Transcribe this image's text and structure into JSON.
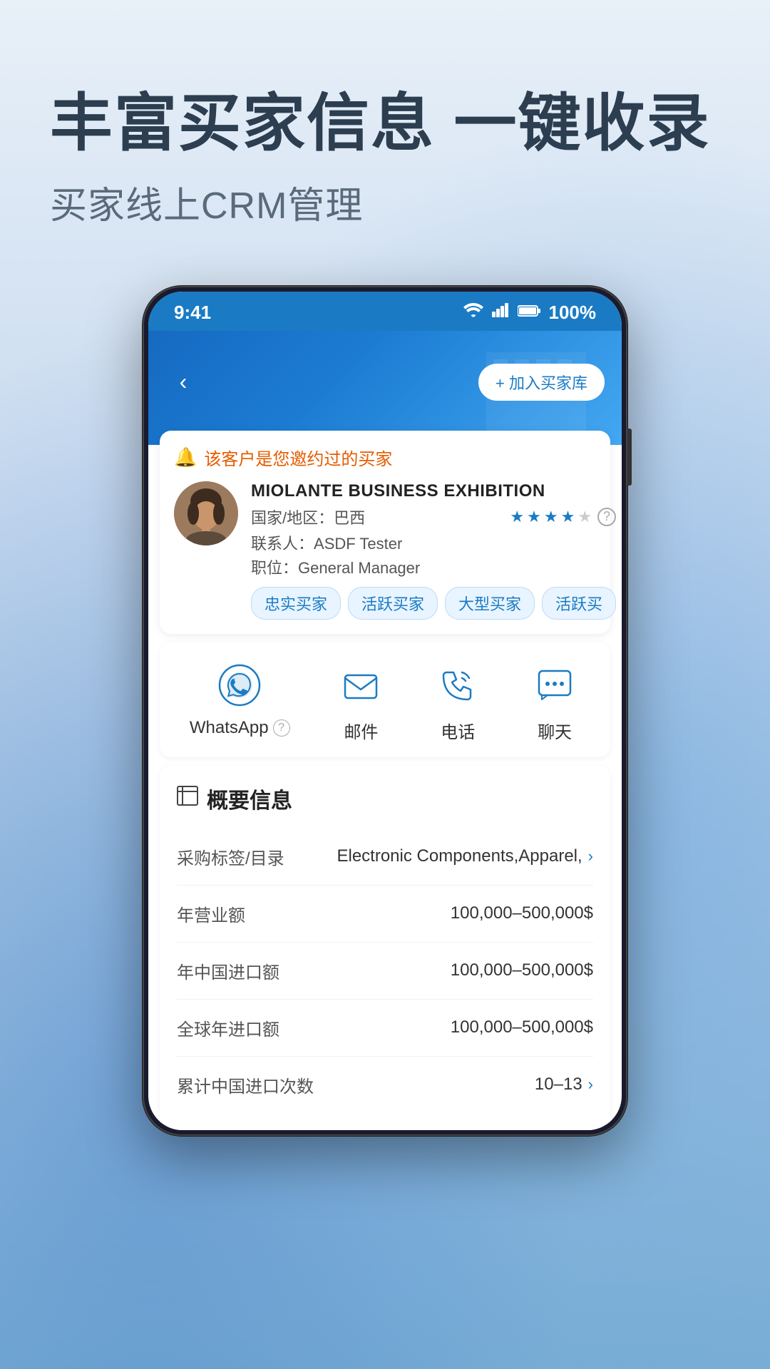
{
  "page": {
    "background": "gradient-blue"
  },
  "header": {
    "main_title": "丰富买家信息 一键收录",
    "sub_title": "买家线上CRM管理"
  },
  "status_bar": {
    "time": "9:41",
    "wifi_icon": "wifi",
    "signal_icon": "signal",
    "battery_icon": "battery",
    "battery_text": "100%"
  },
  "phone_top_bar": {
    "back_label": "‹",
    "add_buyer_label": "+ 加入买家库"
  },
  "customer_notice": {
    "text": "该客户是您邀约过的买家"
  },
  "customer": {
    "company_name": "MIOLANTE BUSINESS EXHIBITION",
    "country_label": "国家/地区：",
    "country": "巴西",
    "stars_filled": 4,
    "stars_empty": 1,
    "contact_label": "联系人：",
    "contact_name": "ASDF Tester",
    "position_label": "职位：",
    "position": "General Manager",
    "tags": [
      "忠实买家",
      "活跃买家",
      "大型买家",
      "活跃买"
    ]
  },
  "actions": [
    {
      "id": "whatsapp",
      "label": "WhatsApp",
      "has_help": true
    },
    {
      "id": "email",
      "label": "邮件",
      "has_help": false
    },
    {
      "id": "phone",
      "label": "电话",
      "has_help": false
    },
    {
      "id": "chat",
      "label": "聊天",
      "has_help": false
    }
  ],
  "overview": {
    "title": "概要信息",
    "rows": [
      {
        "label": "采购标签/目录",
        "value": "Electronic Components,Apparel,",
        "has_chevron": true
      },
      {
        "label": "年营业额",
        "value": "100,000–500,000$",
        "has_chevron": false
      },
      {
        "label": "年中国进口额",
        "value": "100,000–500,000$",
        "has_chevron": false
      },
      {
        "label": "全球年进口额",
        "value": "100,000–500,000$",
        "has_chevron": false
      },
      {
        "label": "累计中国进口次数",
        "value": "10–13",
        "has_chevron": true
      }
    ]
  }
}
